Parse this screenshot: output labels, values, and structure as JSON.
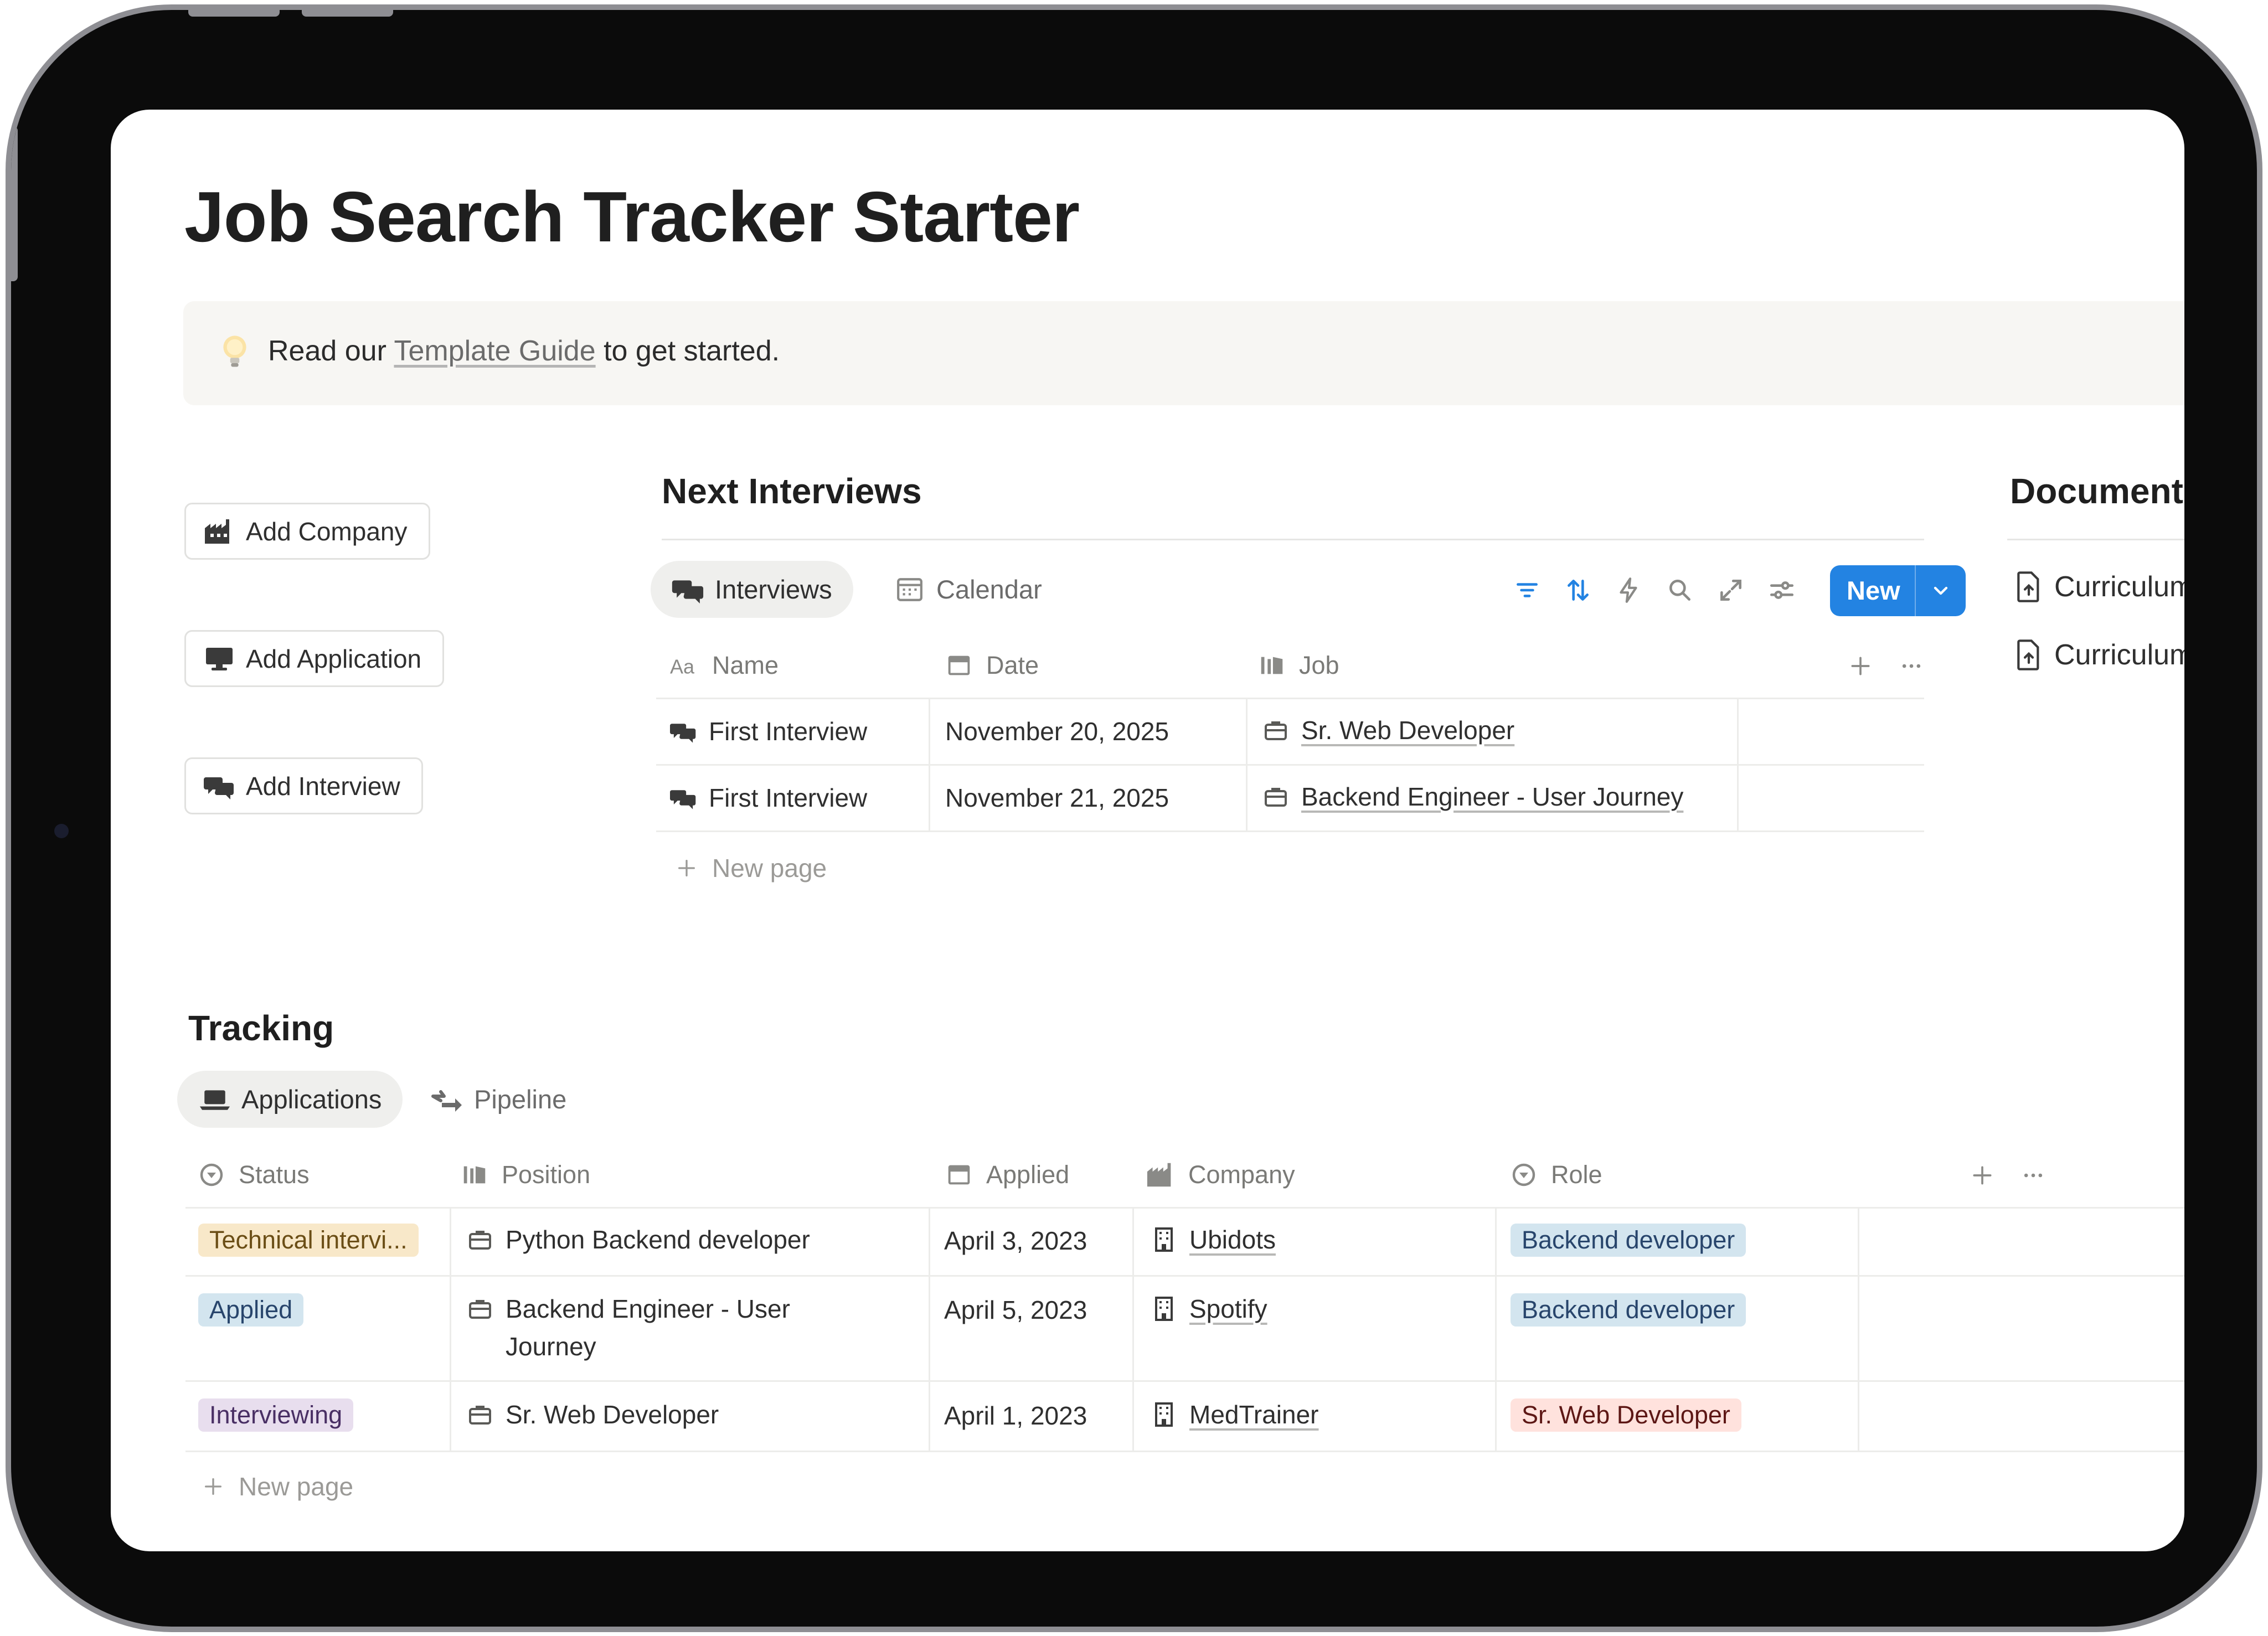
{
  "page": {
    "title": "Job Search Tracker Starter",
    "callout": {
      "prefix": "Read our ",
      "link": "Template Guide",
      "suffix": " to get started."
    }
  },
  "actions": {
    "add_company": "Add Company",
    "add_application": "Add Application",
    "add_interview": "Add Interview"
  },
  "interviews": {
    "heading": "Next Interviews",
    "tabs": [
      {
        "label": "Interviews",
        "icon": "chat-bubbles-icon"
      },
      {
        "label": "Calendar",
        "icon": "calendar-icon"
      }
    ],
    "toolbar": {
      "new_label": "New",
      "icons": [
        "filter-icon",
        "sort-icon",
        "lightning-icon",
        "search-icon",
        "expand-icon",
        "settings-sliders-icon",
        "chevron-down-icon"
      ]
    },
    "columns": [
      "Name",
      "Date",
      "Job"
    ],
    "rows": [
      {
        "name": "First Interview",
        "date": "November 20, 2025",
        "job": "Sr. Web Developer"
      },
      {
        "name": "First Interview",
        "date": "November 21, 2025",
        "job": "Backend Engineer - User Journey"
      }
    ],
    "new_page": "New page"
  },
  "documents": {
    "heading": "Documents",
    "items": [
      "Curriculum",
      "Curriculum"
    ]
  },
  "tracking": {
    "heading": "Tracking",
    "tabs": [
      {
        "label": "Applications",
        "icon": "laptop-icon"
      },
      {
        "label": "Pipeline",
        "icon": "arrows-icon"
      }
    ],
    "columns": [
      "Status",
      "Position",
      "Applied",
      "Company",
      "Role"
    ],
    "rows": [
      {
        "status": "Technical intervi...",
        "status_color": "#f8e8c9",
        "status_text": "#6b4e16",
        "position_1": "Python Backend developer",
        "position_2": "",
        "applied": "April 3, 2023",
        "company": "Ubidots",
        "role": "Backend developer",
        "role_color": "#d3e5ef",
        "role_text": "#28456c"
      },
      {
        "status": "Applied",
        "status_color": "#d3e5ef",
        "status_text": "#28456c",
        "position_1": "Backend Engineer - User",
        "position_2": "Journey",
        "applied": "April 5, 2023",
        "company": "Spotify",
        "role": "Backend developer",
        "role_color": "#d3e5ef",
        "role_text": "#28456c"
      },
      {
        "status": "Interviewing",
        "status_color": "#e8deee",
        "status_text": "#492f64",
        "position_1": "Sr. Web Developer",
        "position_2": "",
        "applied": "April 1, 2023",
        "company": "MedTrainer",
        "role": "Sr. Web Developer",
        "role_color": "#ffe2dd",
        "role_text": "#5d1715"
      }
    ],
    "new_page": "New page"
  },
  "colors": {
    "accent": "#2383e2",
    "frame": "#0b0b0b",
    "callout_bg": "#f7f6f3"
  }
}
